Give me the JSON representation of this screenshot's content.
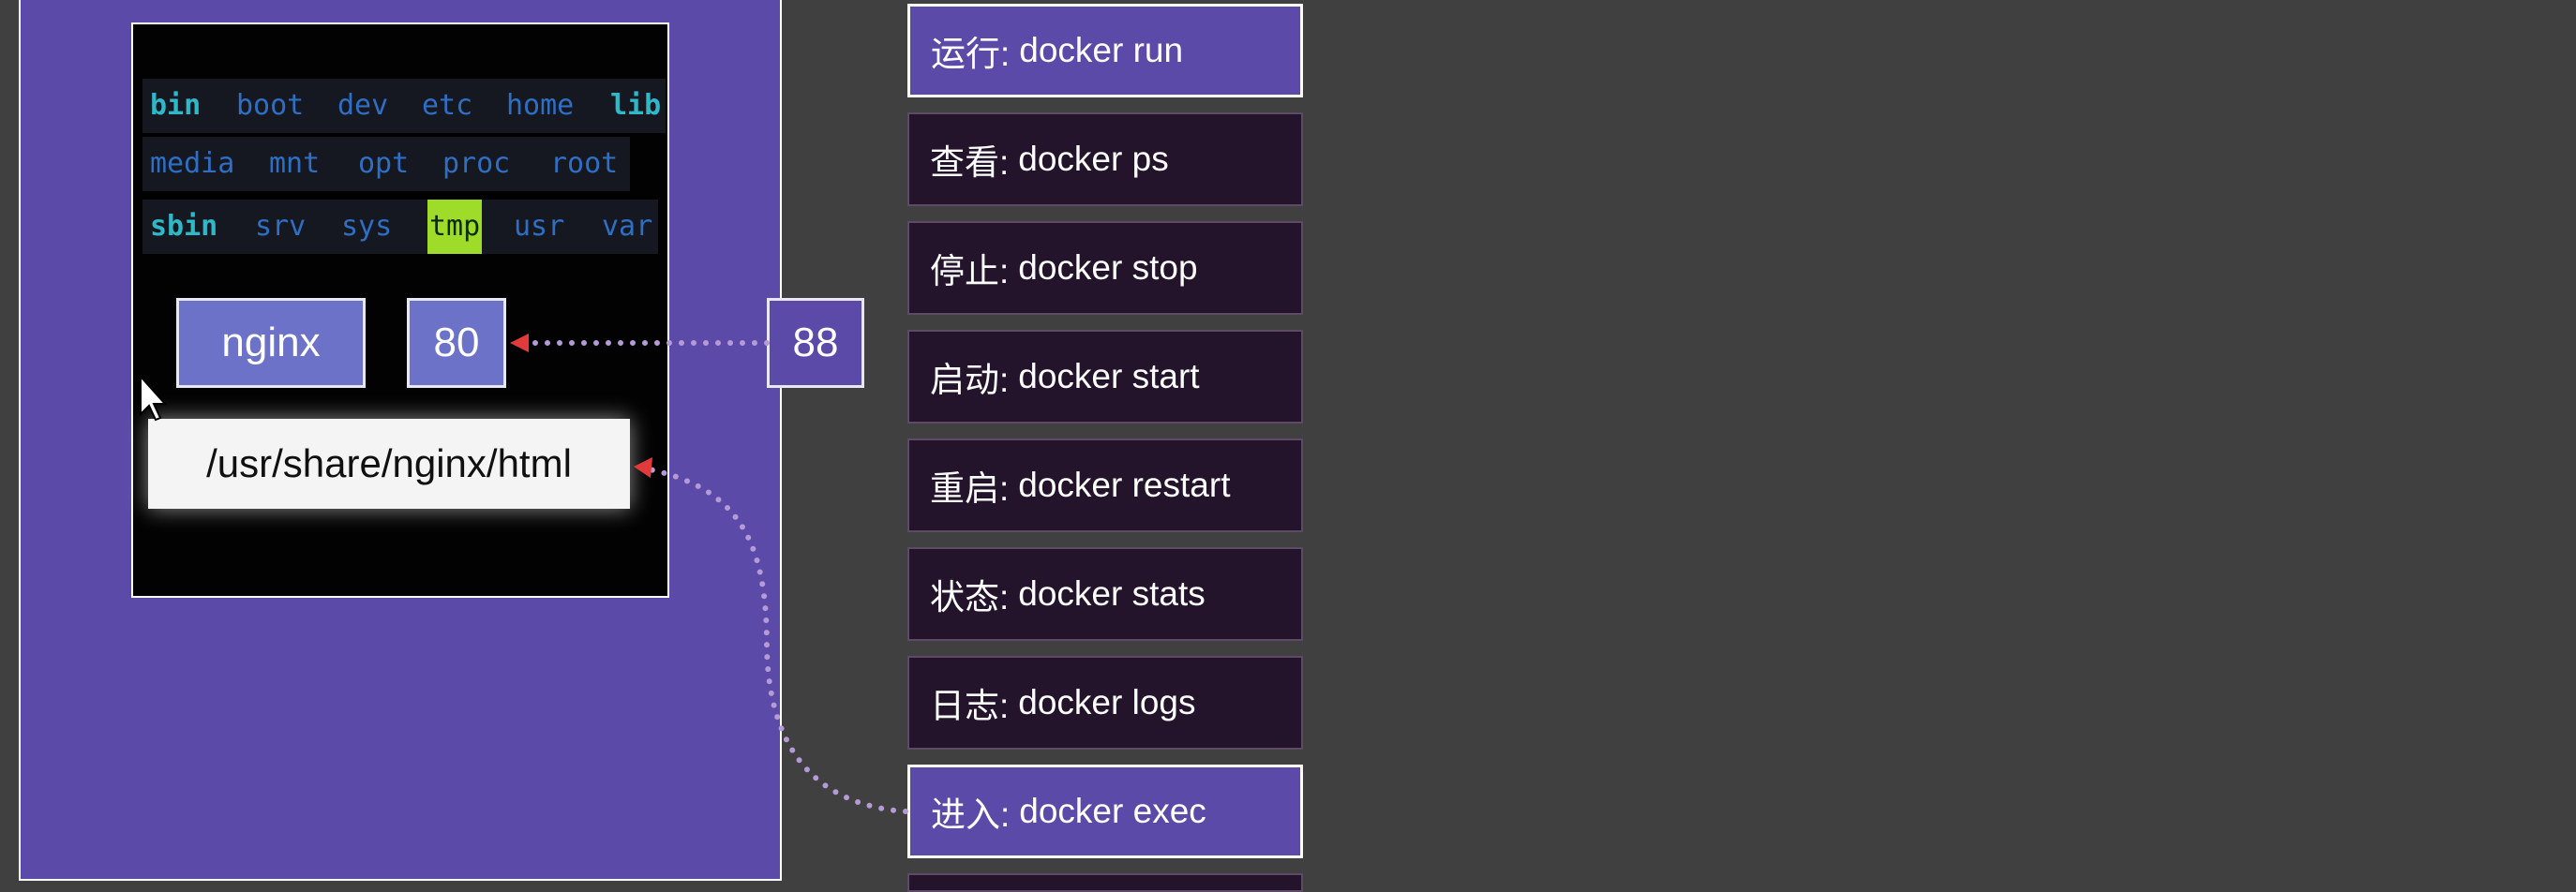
{
  "filesystem": {
    "row1": [
      "bin",
      "boot",
      "dev",
      "etc",
      "home",
      "lib"
    ],
    "row2": [
      "media",
      "mnt",
      "opt",
      "proc",
      "root"
    ],
    "row3": [
      "sbin",
      "srv",
      "sys",
      "tmp",
      "usr",
      "var"
    ]
  },
  "container": {
    "image_label": "nginx",
    "container_port": "80",
    "html_path": "/usr/share/nginx/html"
  },
  "host": {
    "host_port": "88"
  },
  "commands": [
    {
      "name": "运行:",
      "cmd": "docker run",
      "active": true
    },
    {
      "name": "查看:",
      "cmd": "docker ps",
      "active": false
    },
    {
      "name": "停止:",
      "cmd": "docker stop",
      "active": false
    },
    {
      "name": "启动:",
      "cmd": "docker start",
      "active": false
    },
    {
      "name": "重启:",
      "cmd": "docker restart",
      "active": false
    },
    {
      "name": "状态:",
      "cmd": "docker stats",
      "active": false
    },
    {
      "name": "日志:",
      "cmd": "docker logs",
      "active": false
    },
    {
      "name": "进入:",
      "cmd": "docker exec",
      "active": true
    }
  ],
  "colors": {
    "arrow_dots": "#b59ad8",
    "arrow_head": "#e23a3a",
    "active_command": "#5b4aa8",
    "inactive_command": "#23142c"
  }
}
